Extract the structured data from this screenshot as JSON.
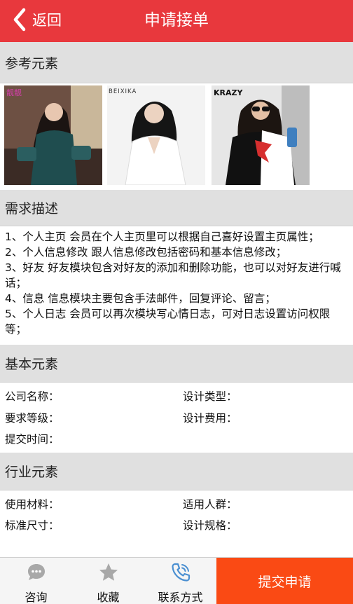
{
  "header": {
    "back_label": "返回",
    "title": "申请接单",
    "color": "#e8383d"
  },
  "reference": {
    "section_title": "参考元素",
    "images": [
      {
        "watermark": "靓靓"
      },
      {
        "watermark": "BEIXIKA"
      },
      {
        "watermark": "KRAZY"
      }
    ]
  },
  "demand": {
    "section_title": "需求描述",
    "lines": [
      "1、个人主页 会员在个人主页里可以根据自己喜好设置主页属性；",
      "2、个人信息修改 跟人信息修改包括密码和基本信息修改；",
      "3、好友 好友模块包含对好友的添加和删除功能，也可以对好友进行喊话；",
      "4、信息 信息模块主要包含手法邮件，回复评论、留言；",
      "5、个人日志 会员可以再次模块写心情日志，可对日志设置访问权限等；"
    ]
  },
  "basic": {
    "section_title": "基本元素",
    "company_name": "公司名称：",
    "design_type": "设计类型：",
    "requirement_level": "要求等级：",
    "design_fee": "设计费用：",
    "submit_time": "提交时间："
  },
  "industry": {
    "section_title": "行业元素",
    "material": "使用材料：",
    "audience": "适用人群：",
    "standard_size": "标准尺寸：",
    "design_spec": "设计规格："
  },
  "bottom_bar": {
    "consult_label": "咨询",
    "favorite_label": "收藏",
    "contact_label": "联系方式",
    "submit_label": "提交申请",
    "submit_color": "#fa4a14",
    "icons": [
      "chat-bubble-icon",
      "star-icon",
      "phone-icon"
    ]
  }
}
